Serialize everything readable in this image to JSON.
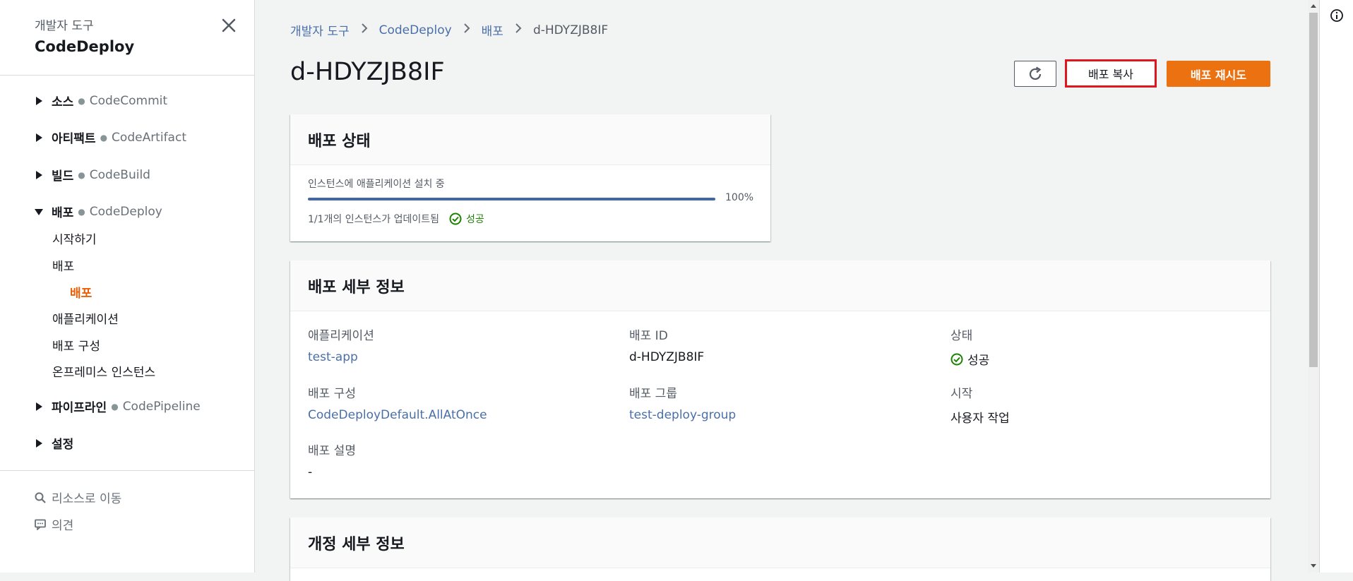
{
  "sidebar": {
    "subtitle": "개발자 도구",
    "title": "CodeDeploy",
    "groups": [
      {
        "name": "소스",
        "service": "CodeCommit"
      },
      {
        "name": "아티팩트",
        "service": "CodeArtifact"
      },
      {
        "name": "빌드",
        "service": "CodeBuild"
      },
      {
        "name": "배포",
        "service": "CodeDeploy"
      },
      {
        "name": "파이프라인",
        "service": "CodePipeline"
      },
      {
        "name": "설정",
        "service": ""
      }
    ],
    "deploy_items": {
      "getting_started": "시작하기",
      "deployments": "배포",
      "deployments_child": "배포",
      "applications": "애플리케이션",
      "deploy_configs": "배포 구성",
      "onprem": "온프레미스 인스턴스"
    },
    "footer": {
      "goto_resource": "리소스로 이동",
      "feedback": "의견"
    }
  },
  "breadcrumb": {
    "items": [
      "개발자 도구",
      "CodeDeploy",
      "배포"
    ],
    "current": "d-HDYZJB8IF"
  },
  "page": {
    "title": "d-HDYZJB8IF",
    "copy_button": "배포 복사",
    "retry_button": "배포 재시도"
  },
  "status_card": {
    "title": "배포 상태",
    "progress_label": "인스턴스에 애플리케이션 설치 중",
    "progress_percent": "100%",
    "progress_value": 100,
    "instances_text": "1/1개의 인스턴스가 업데이트됨",
    "result": "성공"
  },
  "details_card": {
    "title": "배포 세부 정보",
    "application_label": "애플리케이션",
    "application_value": "test-app",
    "deploy_id_label": "배포 ID",
    "deploy_id_value": "d-HDYZJB8IF",
    "status_label": "상태",
    "status_value": "성공",
    "config_label": "배포 구성",
    "config_value": "CodeDeployDefault.AllAtOnce",
    "group_label": "배포 그룹",
    "group_value": "test-deploy-group",
    "start_label": "시작",
    "start_value": "사용자 작업",
    "desc_label": "배포 설명",
    "desc_value": "-"
  },
  "revision_card": {
    "title": "개정 세부 정보"
  },
  "colors": {
    "accent_orange": "#ec7211",
    "active_nav": "#eb5f07",
    "link_blue": "#4a6fa8",
    "success_green": "#1d8102",
    "highlight_red": "#e0161f"
  }
}
